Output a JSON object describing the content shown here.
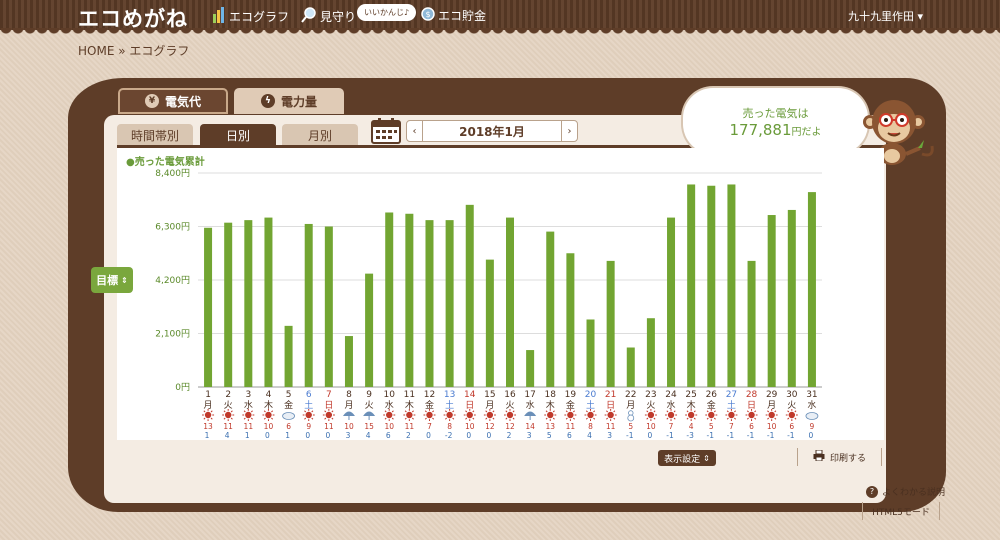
{
  "app": {
    "logo": "エコめがね"
  },
  "nav": {
    "items": [
      {
        "label": "エコグラフ",
        "icon": "bar-chart-icon"
      },
      {
        "label": "見守り",
        "icon": "magnifier-icon"
      },
      {
        "label": "エコ貯金",
        "icon": "coin-icon"
      }
    ],
    "bubble": "いいかんじ♪",
    "user": "九十九里作田"
  },
  "breadcrumb": {
    "home": "HOME",
    "sep": "»",
    "current": "エコグラフ"
  },
  "tabs": [
    {
      "label": "電気代",
      "icon": "yen-icon",
      "active": true
    },
    {
      "label": "電力量",
      "icon": "lightning-icon",
      "active": false
    }
  ],
  "subtabs": [
    {
      "label": "時間帯別",
      "active": false
    },
    {
      "label": "日別",
      "active": true
    },
    {
      "label": "月別",
      "active": false
    }
  ],
  "date_nav": {
    "prev": "‹",
    "label": "2018年1月",
    "next": "›"
  },
  "sold_message": {
    "line1": "売った電気は",
    "amount": "177,881",
    "suffix": "円だよ"
  },
  "goal_button": "目標",
  "display_settings": "表示設定",
  "print_label": "印刷する",
  "help_label": "よくわかる説明",
  "html5_label": "HTML5モード",
  "colors": {
    "brown": "#5e3d28",
    "bar": "#72a532",
    "sat": "#4a7bd0",
    "sun": "#c0392b",
    "weekday": "#c0392b"
  },
  "chart_data": {
    "type": "bar",
    "title": "●売った電気累計",
    "ylim": [
      0,
      8400
    ],
    "yticks": [
      "0円",
      "2,100円",
      "4,200円",
      "6,300円",
      "8,400円"
    ],
    "categories": [
      "1",
      "2",
      "3",
      "4",
      "5",
      "6",
      "7",
      "8",
      "9",
      "10",
      "11",
      "12",
      "13",
      "14",
      "15",
      "16",
      "17",
      "18",
      "19",
      "20",
      "21",
      "22",
      "23",
      "24",
      "25",
      "26",
      "27",
      "28",
      "29",
      "30",
      "31"
    ],
    "weekdays": [
      "月",
      "火",
      "水",
      "木",
      "金",
      "土",
      "日",
      "月",
      "火",
      "水",
      "木",
      "金",
      "土",
      "日",
      "月",
      "火",
      "水",
      "木",
      "金",
      "土",
      "日",
      "月",
      "火",
      "水",
      "木",
      "金",
      "土",
      "日",
      "月",
      "火",
      "水"
    ],
    "weather": [
      "sun",
      "sun",
      "sun",
      "sun",
      "cloud",
      "sun",
      "sun",
      "rain",
      "rain",
      "sun",
      "sun",
      "sun",
      "sun",
      "sun",
      "sun",
      "sun",
      "rain",
      "sun",
      "sun",
      "sun",
      "sun",
      "snow",
      "sun",
      "sun",
      "sun",
      "sun",
      "sun",
      "sun",
      "sun",
      "sun",
      "cloud"
    ],
    "temp_high": [
      "13",
      "11",
      "11",
      "10",
      "6",
      "9",
      "11",
      "10",
      "15",
      "10",
      "11",
      "7",
      "8",
      "10",
      "12",
      "12",
      "14",
      "13",
      "11",
      "8",
      "11",
      "5",
      "10",
      "7",
      "4",
      "5",
      "7",
      "6",
      "10",
      "6",
      "9"
    ],
    "temp_low": [
      "1",
      "4",
      "1",
      "0",
      "1",
      "0",
      "0",
      "3",
      "4",
      "6",
      "2",
      "0",
      "-2",
      "0",
      "0",
      "2",
      "3",
      "5",
      "6",
      "4",
      "3",
      "-1",
      "0",
      "-1",
      "-3",
      "-1",
      "-1",
      "-1",
      "-1",
      "-1",
      "0"
    ],
    "values": [
      6250,
      6450,
      6550,
      6650,
      2400,
      6400,
      6300,
      2000,
      4450,
      6850,
      6800,
      6550,
      6550,
      7150,
      5000,
      6650,
      1450,
      6100,
      5250,
      2650,
      4950,
      1550,
      2700,
      6650,
      7950,
      7900,
      7950,
      4950,
      6750,
      6950,
      7650
    ],
    "grid": true
  }
}
